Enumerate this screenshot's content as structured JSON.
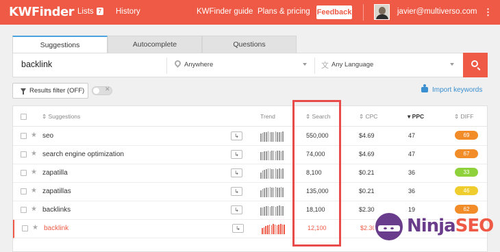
{
  "brand": {
    "logo_text_left": "KW",
    "logo_text_right": "Finder"
  },
  "topnav": {
    "lists_label": "Lists",
    "lists_count": "7",
    "history_label": "History",
    "guide_label": "KWFinder guide",
    "plans_label": "Plans & pricing",
    "feedback_label": "Feedback",
    "user_email": "javier@multiverso.com",
    "menu_glyph": "⋮"
  },
  "tabs": [
    {
      "label": "Suggestions",
      "active": true
    },
    {
      "label": "Autocomplete",
      "active": false
    },
    {
      "label": "Questions",
      "active": false
    }
  ],
  "search": {
    "keyword": "backlink",
    "location": "Anywhere",
    "language": "Any Language"
  },
  "filters": {
    "results_filter_label": "Results filter (OFF)",
    "toggle_off_glyph": "✕",
    "import_label": "Import keywords"
  },
  "table": {
    "headers": {
      "suggestions": "Suggestions",
      "trend": "Trend",
      "search": "Search",
      "cpc": "CPC",
      "ppc": "PPC",
      "diff": "DIFF"
    },
    "sort_glyph": "⇕",
    "sorted_glyph": "▾",
    "go_glyph": "↳",
    "star_glyph": "★",
    "rows": [
      {
        "keyword": "seo",
        "search": "550,000",
        "cpc": "$4.69",
        "ppc": "47",
        "diff": "69",
        "diff_color": "#f28c28",
        "trend": [
          10,
          11,
          12,
          12,
          13,
          12,
          12,
          12,
          13,
          12,
          12,
          12,
          13
        ]
      },
      {
        "keyword": "search engine optimization",
        "search": "74,000",
        "cpc": "$4.69",
        "ppc": "47",
        "diff": "67",
        "diff_color": "#f28c28",
        "trend": [
          10,
          10,
          11,
          11,
          12,
          11,
          12,
          12,
          11,
          12,
          12,
          11,
          12
        ]
      },
      {
        "keyword": "zapatilla",
        "search": "8,100",
        "cpc": "$0.21",
        "ppc": "36",
        "diff": "33",
        "diff_color": "#8fd13a",
        "trend": [
          8,
          10,
          11,
          12,
          13,
          13,
          12,
          12,
          13,
          12,
          13,
          12,
          13
        ]
      },
      {
        "keyword": "zapatillas",
        "search": "135,000",
        "cpc": "$0.21",
        "ppc": "36",
        "diff": "46",
        "diff_color": "#f0cd2e",
        "trend": [
          9,
          10,
          11,
          12,
          12,
          13,
          12,
          12,
          13,
          12,
          12,
          13,
          12
        ]
      },
      {
        "keyword": "backlinks",
        "search": "18,100",
        "cpc": "$2.30",
        "ppc": "19",
        "diff": "62",
        "diff_color": "#f28c28",
        "trend": [
          10,
          10,
          11,
          12,
          12,
          11,
          12,
          12,
          11,
          12,
          13,
          12,
          12
        ]
      },
      {
        "keyword": "backlink",
        "search": "12,100",
        "cpc": "$2.30",
        "ppc": "",
        "diff": "",
        "diff_color": "#f28c28",
        "trend": [
          8,
          9,
          10,
          11,
          12,
          11,
          13,
          12,
          11,
          12,
          13,
          12,
          12
        ],
        "active": true
      }
    ]
  },
  "watermark": {
    "part1": "Ninja",
    "part2": "SEO",
    "badge_letter": "S"
  }
}
